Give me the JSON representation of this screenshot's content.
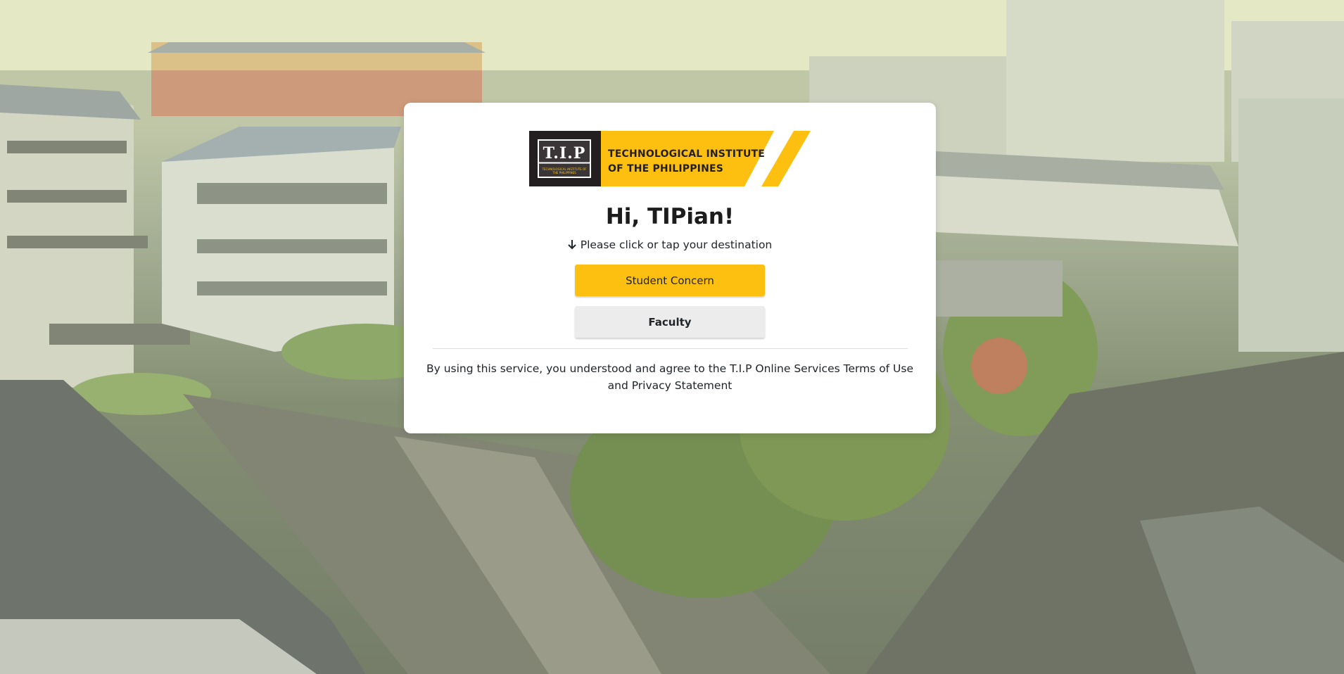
{
  "logo": {
    "mark_text": "T.I.P",
    "mark_subtext": "TECHNOLOGICAL INSTITUTE OF THE PHILIPPINES",
    "title_line1": "TECHNOLOGICAL INSTITUTE",
    "title_line2": "OF THE PHILIPPINES",
    "brand_yellow": "#fdc010",
    "brand_dark": "#231f20"
  },
  "greeting": "Hi, TIPian!",
  "instruction": {
    "icon": "arrow-down-icon",
    "text": "Please click or tap your destination"
  },
  "buttons": {
    "student_concern": "Student Concern",
    "faculty": "Faculty"
  },
  "terms": "By using this service, you understood and agree to the T.I.P Online Services Terms of Use and Privacy Statement"
}
